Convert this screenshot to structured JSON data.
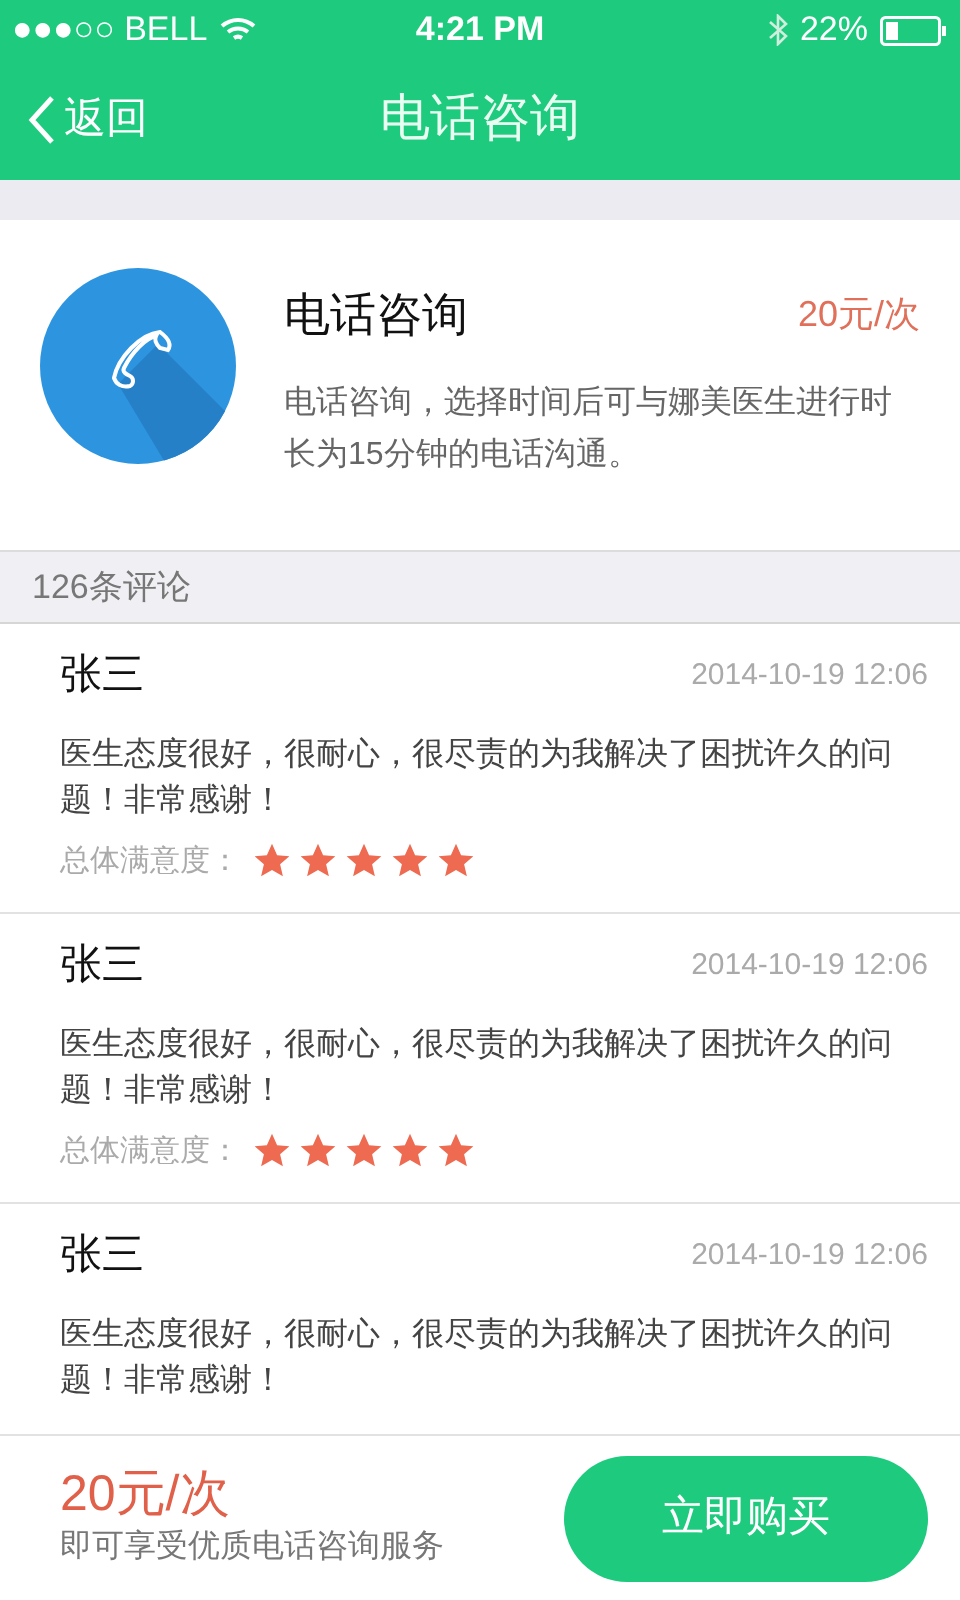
{
  "status_bar": {
    "carrier": "●●●○○ BELL",
    "time": "4:21 PM",
    "battery": "22%"
  },
  "nav": {
    "back": "返回",
    "title": "电话咨询"
  },
  "service": {
    "title": "电话咨询",
    "price": "20元/次",
    "description": "电话咨询，选择时间后可与娜美医生进行时长为15分钟的电话沟通。"
  },
  "comments_header": "126条评论",
  "reviews": [
    {
      "name": "张三",
      "date": "2014-10-19 12:06",
      "text": "医生态度很好，很耐心，很尽责的为我解决了困扰许久的问题！非常感谢！",
      "rating_label": "总体满意度：",
      "stars": 5
    },
    {
      "name": "张三",
      "date": "2014-10-19 12:06",
      "text": "医生态度很好，很耐心，很尽责的为我解决了困扰许久的问题！非常感谢！",
      "rating_label": "总体满意度：",
      "stars": 5
    },
    {
      "name": "张三",
      "date": "2014-10-19 12:06",
      "text": "医生态度很好，很耐心，很尽责的为我解决了困扰许久的问题！非常感谢！"
    }
  ],
  "footer": {
    "price": "20元/次",
    "note": "即可享受优质电话咨询服务",
    "button": "立即购买"
  }
}
